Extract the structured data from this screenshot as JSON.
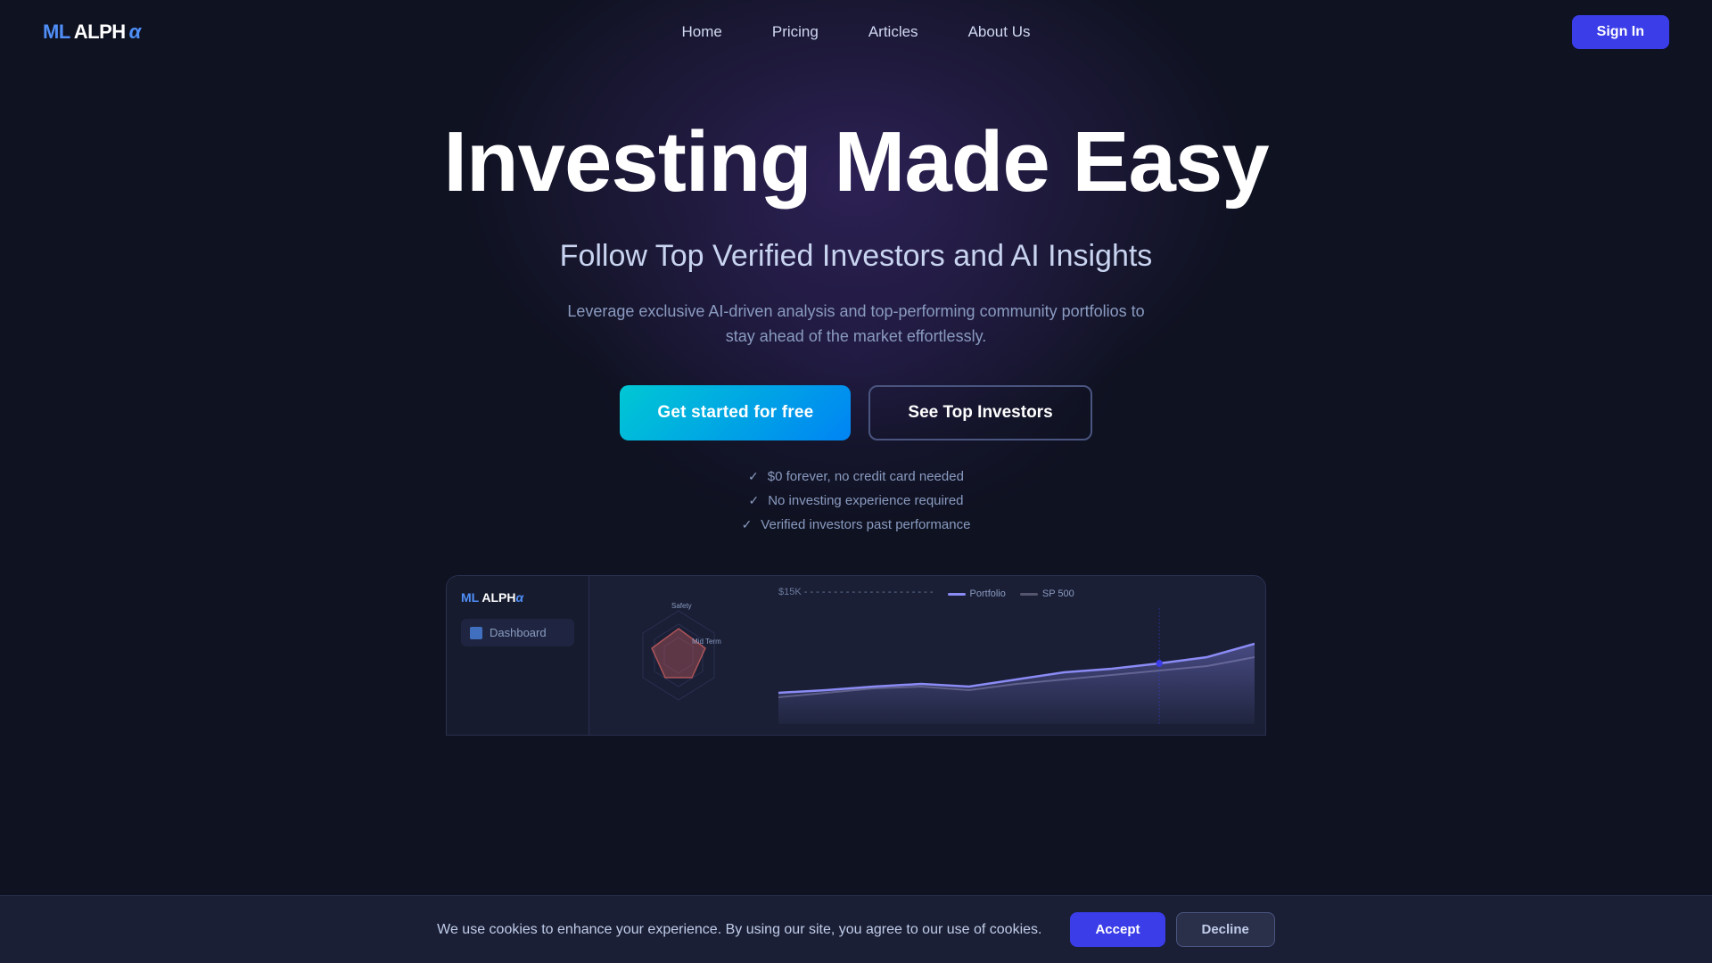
{
  "nav": {
    "logo": {
      "ml": "ML",
      "alpha": "ALPH",
      "omega": "α"
    },
    "links": [
      {
        "label": "Home",
        "id": "home"
      },
      {
        "label": "Pricing",
        "id": "pricing"
      },
      {
        "label": "Articles",
        "id": "articles"
      },
      {
        "label": "About Us",
        "id": "about"
      }
    ],
    "sign_in": "Sign In"
  },
  "hero": {
    "title": "Investing Made Easy",
    "subtitle": "Follow Top Verified Investors and AI Insights",
    "description": "Leverage exclusive AI-driven analysis and top-performing community portfolios to stay ahead of the market effortlessly.",
    "cta_primary": "Get started for free",
    "cta_secondary": "See Top Investors",
    "features": [
      "$0 forever, no credit card needed",
      "No investing experience required",
      "Verified investors past performance"
    ]
  },
  "dashboard": {
    "sidebar": {
      "logo": "ML ALPHα",
      "item": "Dashboard"
    },
    "chart": {
      "label": "$15K",
      "legend": [
        {
          "label": "Portfolio",
          "color": "#8b8bf5"
        },
        {
          "label": "SP 500",
          "color": "#555570"
        }
      ]
    },
    "radar": {
      "labels": [
        "Safety",
        "Mid Term"
      ]
    }
  },
  "cookie": {
    "text": "We use cookies to enhance your experience. By using our site, you agree to our use of cookies.",
    "accept": "Accept",
    "decline": "Decline"
  },
  "colors": {
    "primary": "#3a3de8",
    "accent": "#00c8d4",
    "portfolio_line": "#8b8bf5",
    "sp500_line": "#555570"
  }
}
